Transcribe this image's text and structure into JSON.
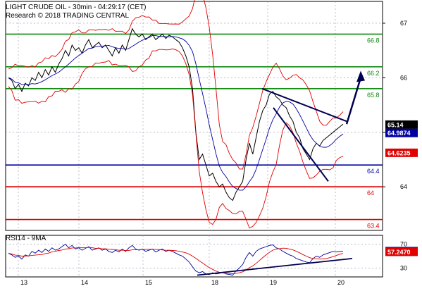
{
  "chart_data": {
    "type": "line",
    "title": "LIGHT CRUDE OIL - 30min - 04:29:17 (CET)",
    "subtitle": "Research © 2018 TRADING CENTRAL",
    "x_labels": [
      "13",
      "14",
      "15",
      "18",
      "19",
      "20"
    ],
    "y_ticks": [
      64,
      65,
      66,
      67
    ],
    "ylim": [
      63.2,
      67.4
    ],
    "levels": [
      {
        "value": 66.8,
        "label": "66.8",
        "color": "#108a10"
      },
      {
        "value": 66.2,
        "label": "66.2",
        "color": "#108a10"
      },
      {
        "value": 65.8,
        "label": "65.8",
        "color": "#108a10"
      },
      {
        "value": 64.4,
        "label": "64.4",
        "color": "#0000a0"
      },
      {
        "value": 64.0,
        "label": "64",
        "color": "#e00000"
      },
      {
        "value": 63.4,
        "label": "63.4",
        "color": "#e00000"
      }
    ],
    "price_series": {
      "name": "price",
      "color": "#000000",
      "values": [
        66.0,
        65.95,
        65.8,
        65.88,
        65.75,
        65.9,
        65.85,
        66.0,
        65.95,
        66.1,
        66.0,
        66.15,
        66.05,
        66.2,
        66.1,
        66.25,
        66.35,
        66.5,
        66.4,
        66.6,
        66.5,
        66.55,
        66.45,
        66.6,
        66.7,
        66.55,
        66.6,
        66.65,
        66.55,
        66.6,
        66.5,
        66.4,
        66.55,
        66.45,
        66.6,
        66.5,
        66.7,
        66.9,
        66.8,
        66.75,
        66.8,
        66.7,
        66.75,
        66.8,
        66.7,
        66.75,
        66.8,
        66.72,
        66.78,
        66.75,
        66.7,
        66.65,
        66.55,
        66.4,
        66.2,
        65.8,
        65.0,
        64.5,
        64.6,
        64.4,
        64.2,
        64.25,
        64.1,
        64.0,
        64.05,
        63.9,
        63.8,
        63.75,
        63.9,
        64.0,
        64.1,
        64.5,
        64.8,
        64.6,
        64.9,
        65.2,
        65.4,
        65.5,
        65.7,
        65.75,
        65.65,
        65.6,
        65.5,
        65.45,
        65.3,
        65.2,
        65.0,
        64.9,
        64.7,
        64.6,
        64.5,
        64.7,
        64.8,
        64.75,
        64.85,
        64.9,
        64.95,
        65.0,
        65.05,
        65.1,
        65.15
      ]
    },
    "bollinger_color": "#e00000",
    "ma_color": "#0000a0",
    "last_price": {
      "label": "65.14",
      "value": 65.14,
      "color": "#000000"
    },
    "ma_value": {
      "label": "64.9874",
      "value": 64.9874,
      "color": "#0000a0"
    },
    "band_value": {
      "label": "64.6235",
      "value": 64.6235,
      "color": "#e00000"
    },
    "rsi": {
      "title": "RSI14 - 9MA",
      "y_ticks": [
        30,
        70
      ],
      "ylim": [
        15,
        85
      ],
      "last": {
        "label": "58.3653",
        "value": 58.3653,
        "color": "#0000a0"
      },
      "ma_last": {
        "label": "57.2470",
        "value": 57.247,
        "color": "#e00000"
      },
      "values": [
        55,
        52,
        48,
        50,
        45,
        52,
        50,
        58,
        55,
        60,
        56,
        62,
        58,
        64,
        60,
        62,
        66,
        70,
        64,
        68,
        62,
        64,
        60,
        63,
        66,
        60,
        62,
        64,
        60,
        62,
        58,
        56,
        60,
        57,
        62,
        58,
        64,
        68,
        62,
        60,
        62,
        58,
        60,
        62,
        57,
        60,
        62,
        58,
        60,
        58,
        55,
        52,
        50,
        45,
        40,
        32,
        25,
        22,
        24,
        20,
        19,
        22,
        20,
        21,
        23,
        20,
        19,
        18,
        25,
        30,
        36,
        48,
        56,
        50,
        58,
        62,
        64,
        66,
        68,
        69,
        64,
        62,
        58,
        55,
        52,
        50,
        46,
        44,
        42,
        40,
        39,
        46,
        50,
        48,
        52,
        54,
        56,
        58,
        57,
        58,
        58.4
      ]
    }
  }
}
